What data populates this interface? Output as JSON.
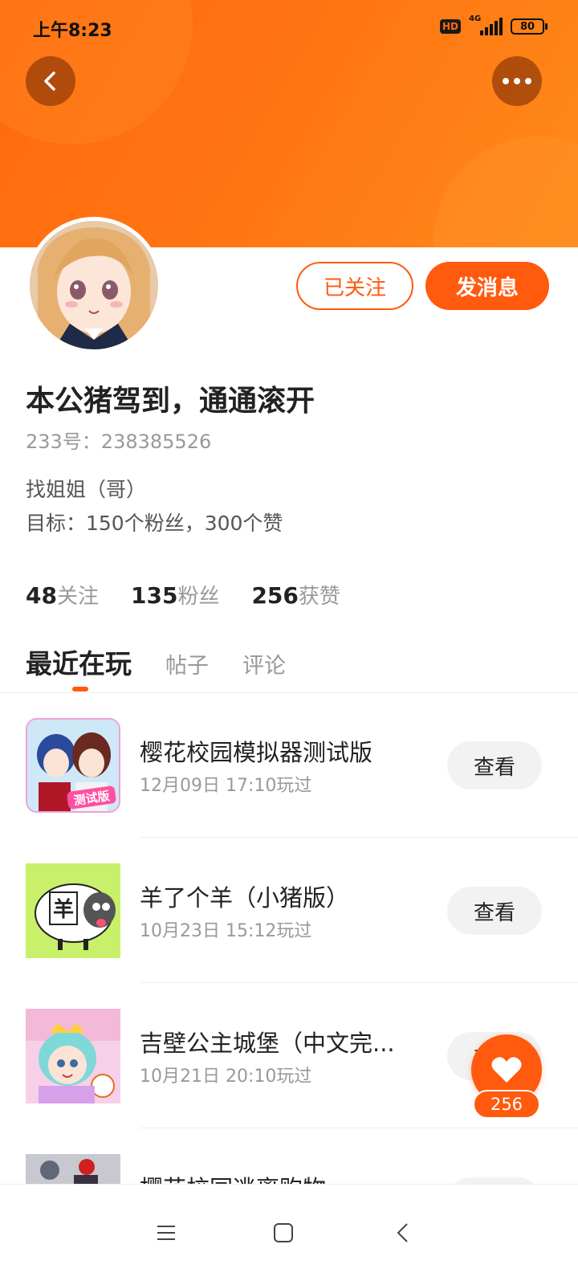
{
  "status_bar": {
    "time": "上午8:23",
    "hd_label": "HD",
    "network_label": "4G",
    "battery": "80"
  },
  "profile": {
    "follow_label": "已关注",
    "message_label": "发消息",
    "username": "本公猪驾到，通通滚开",
    "id_text": "233号：238385526",
    "bio_line1": "找姐姐（哥）",
    "bio_line2": "目标：150个粉丝，300个赞"
  },
  "stats": [
    {
      "num": "48",
      "label": "关注"
    },
    {
      "num": "135",
      "label": "粉丝"
    },
    {
      "num": "256",
      "label": "获赞"
    }
  ],
  "tabs": [
    {
      "label": "最近在玩",
      "active": true
    },
    {
      "label": "帖子",
      "active": false
    },
    {
      "label": "评论",
      "active": false
    }
  ],
  "games": [
    {
      "title": "樱花校园模拟器测试版",
      "time": "12月09日 17:10玩过",
      "button": "查看",
      "thumb_badge": "测试版"
    },
    {
      "title": "羊了个羊（小猪版）",
      "time": "10月23日 15:12玩过",
      "button": "查看",
      "thumb_badge": "羊"
    },
    {
      "title": "吉壁公主城堡（中文完...",
      "time": "10月21日 20:10玩过",
      "button": "查看",
      "thumb_badge": ""
    },
    {
      "title": "樱花校园逃离购物",
      "time": "",
      "button": "",
      "thumb_badge": ""
    }
  ],
  "like_fab": {
    "count": "256"
  },
  "icons": {
    "back": "chevron-left-icon",
    "more": "more-dots-icon",
    "like": "heart-icon",
    "nav_menu": "menu-icon",
    "nav_home": "square-icon",
    "nav_back": "chevron-left-icon"
  },
  "colors": {
    "accent": "#ff5a0d",
    "banner": "#ff7412"
  }
}
